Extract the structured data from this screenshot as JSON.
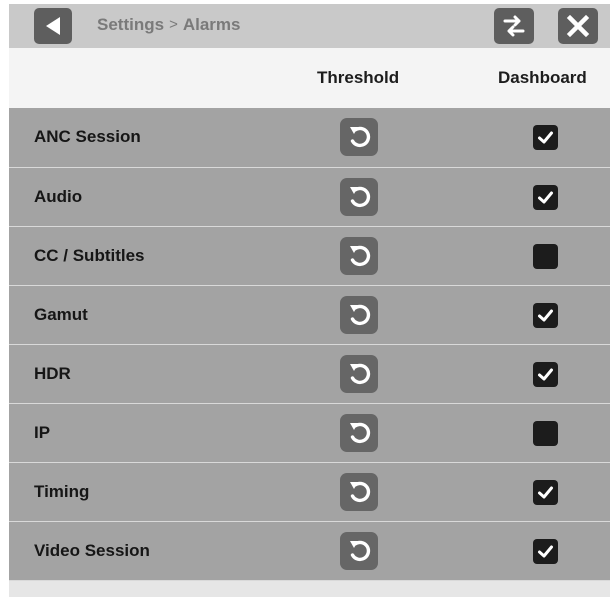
{
  "header": {
    "breadcrumb_parent": "Settings",
    "breadcrumb_separator": ">",
    "breadcrumb_current": "Alarms",
    "back_icon": "triangle-left-icon",
    "swap_icon": "swap-arrows-icon",
    "close_icon": "close-x-icon"
  },
  "columns": {
    "threshold": "Threshold",
    "dashboard": "Dashboard"
  },
  "alarms": [
    {
      "label": "ANC Session",
      "dashboard": true
    },
    {
      "label": "Audio",
      "dashboard": true
    },
    {
      "label": "CC / Subtitles",
      "dashboard": false
    },
    {
      "label": "Gamut",
      "dashboard": true
    },
    {
      "label": "HDR",
      "dashboard": true
    },
    {
      "label": "IP",
      "dashboard": false
    },
    {
      "label": "Timing",
      "dashboard": true
    },
    {
      "label": "Video Session",
      "dashboard": true
    }
  ],
  "colors": {
    "titlebar": "#c9c9c9",
    "row": "#a3a3a3",
    "button": "#5e5e5e",
    "checkbox": "#1c1c1c"
  }
}
